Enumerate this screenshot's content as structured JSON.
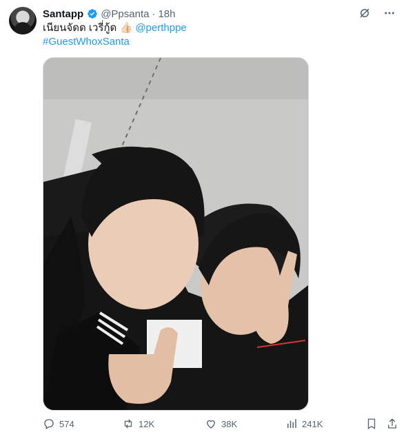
{
  "tweet": {
    "author_name": "Santapp",
    "handle": "@Ppsanta",
    "separator": "·",
    "time": "18h",
    "text_thai": "เนียนจัดด เวรี่กู้ด",
    "emoji": "👍🏻",
    "mention": "@perthppe",
    "hashtag": "#GuestWhoxSanta"
  },
  "stats": {
    "replies": "574",
    "reposts": "12K",
    "likes": "38K",
    "views": "241K"
  },
  "icons": {
    "grok": "grok-icon",
    "more": "more-icon",
    "reply": "reply-icon",
    "repost": "repost-icon",
    "like": "like-icon",
    "views": "views-icon",
    "bookmark": "bookmark-icon",
    "share": "share-icon"
  },
  "colors": {
    "link": "#1d9bf0",
    "verified": "#1d9bf0",
    "muted": "#536471"
  }
}
